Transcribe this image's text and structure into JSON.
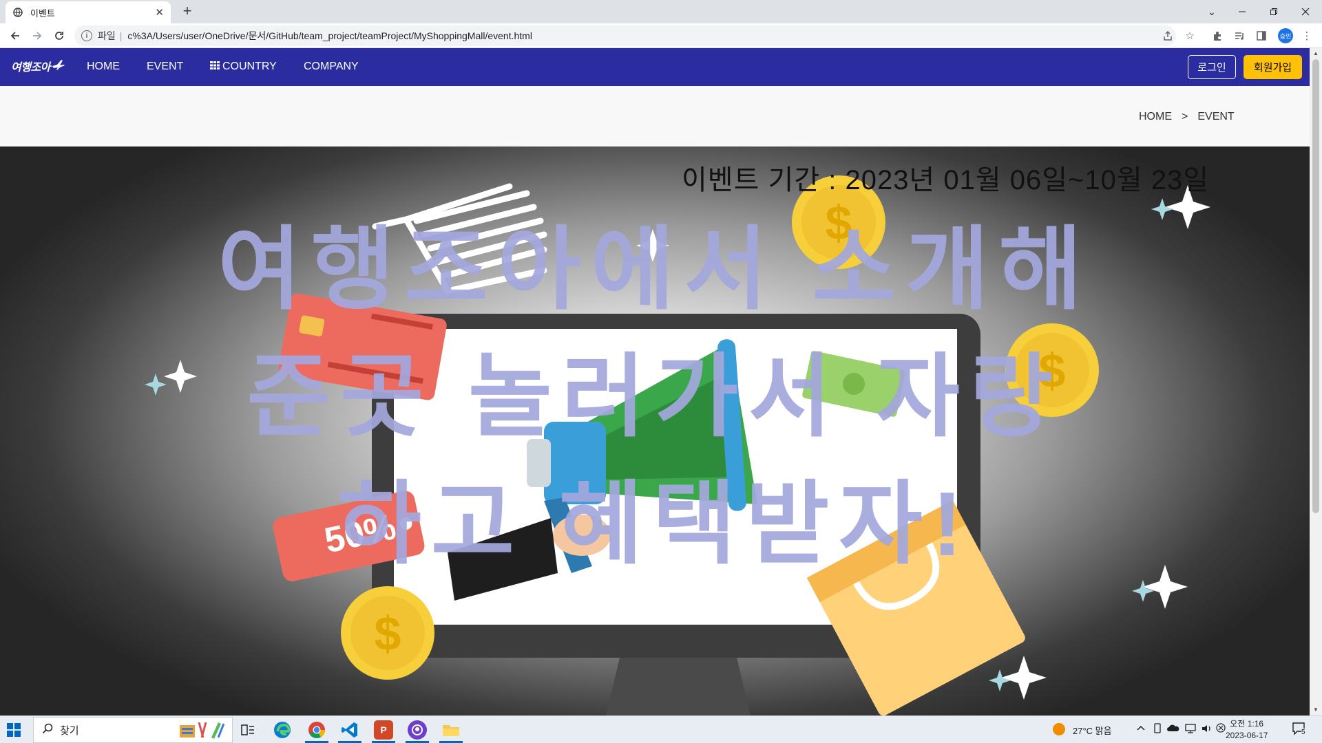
{
  "browser": {
    "tab_title": "이벤트",
    "tab_close": "✕",
    "new_tab": "+",
    "address_scheme": "파일",
    "address_separator": "|",
    "address_url": "c%3A/Users/user/OneDrive/문서/GitHub/team_project/teamProject/MyShoppingMall/event.html",
    "profile_initials": "승민"
  },
  "site": {
    "logo_text": "여행조아",
    "nav": [
      "HOME",
      "EVENT",
      "COUNTRY",
      "COMPANY"
    ],
    "login_label": "로그인",
    "join_label": "회원가입",
    "brand_color": "#2a2c9f",
    "join_color": "#ffc107"
  },
  "breadcrumb": {
    "home": "HOME",
    "separator": ">",
    "current": "EVENT"
  },
  "banner": {
    "period": "이벤트 기간 : 2023년 01월 06일~10월 23일",
    "headline_lines": [
      "여행조아에서 소개해",
      "준곳 놀러가서 자랑",
      "하고 혜택받자!"
    ],
    "coin_symbol": "$",
    "tag_text": "50%",
    "headline_color": "#a3a8dd"
  },
  "taskbar": {
    "search_placeholder": "찾기",
    "weather": "27°C 맑음",
    "time": "오전 1:16",
    "date": "2023-06-17",
    "notification_count": "5"
  }
}
